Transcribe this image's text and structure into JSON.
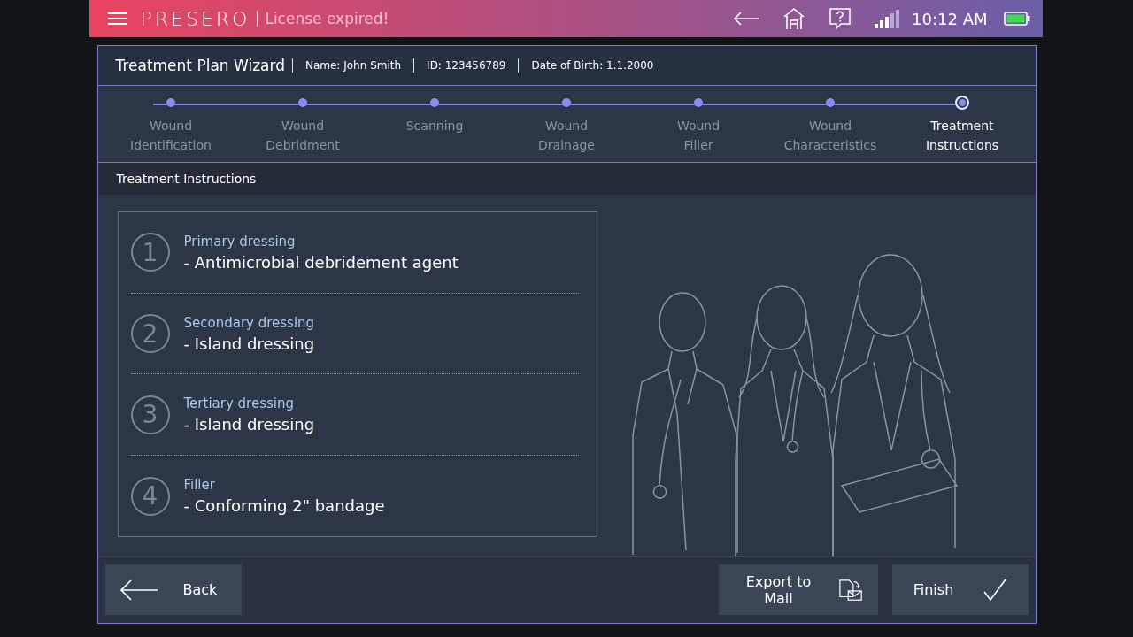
{
  "app_bar": {
    "brand": "PRESERO",
    "status": "License expired!",
    "time": "10:12 AM"
  },
  "header": {
    "title": "Treatment Plan Wizard",
    "fields": [
      "Name: John Smith",
      "ID: 123456789",
      "Date of Birth:  1.1.2000"
    ]
  },
  "steps": [
    {
      "label_lines": [
        "Wound",
        "Identification"
      ],
      "selected": false
    },
    {
      "label_lines": [
        "Wound",
        "Debridment"
      ],
      "selected": false
    },
    {
      "label_lines": [
        "Scanning"
      ],
      "selected": false
    },
    {
      "label_lines": [
        "Wound",
        "Drainage"
      ],
      "selected": false
    },
    {
      "label_lines": [
        "Wound",
        "Filler"
      ],
      "selected": false
    },
    {
      "label_lines": [
        "Wound",
        "Characteristics"
      ],
      "selected": false
    },
    {
      "label_lines": [
        "Treatment",
        "Instructions"
      ],
      "selected": true
    }
  ],
  "section_title": "Treatment Instructions",
  "instructions": [
    {
      "number": "1",
      "title": "Primary dressing",
      "detail": "- Antimicrobial debridement agent"
    },
    {
      "number": "2",
      "title": "Secondary dressing",
      "detail": "- Island dressing"
    },
    {
      "number": "3",
      "title": "Tertiary dressing",
      "detail": "- Island dressing"
    },
    {
      "number": "4",
      "title": "Filler",
      "detail": "- Conforming 2\" bandage"
    }
  ],
  "buttons": {
    "back": "Back",
    "export": "Export to Mail",
    "finish": "Finish"
  }
}
